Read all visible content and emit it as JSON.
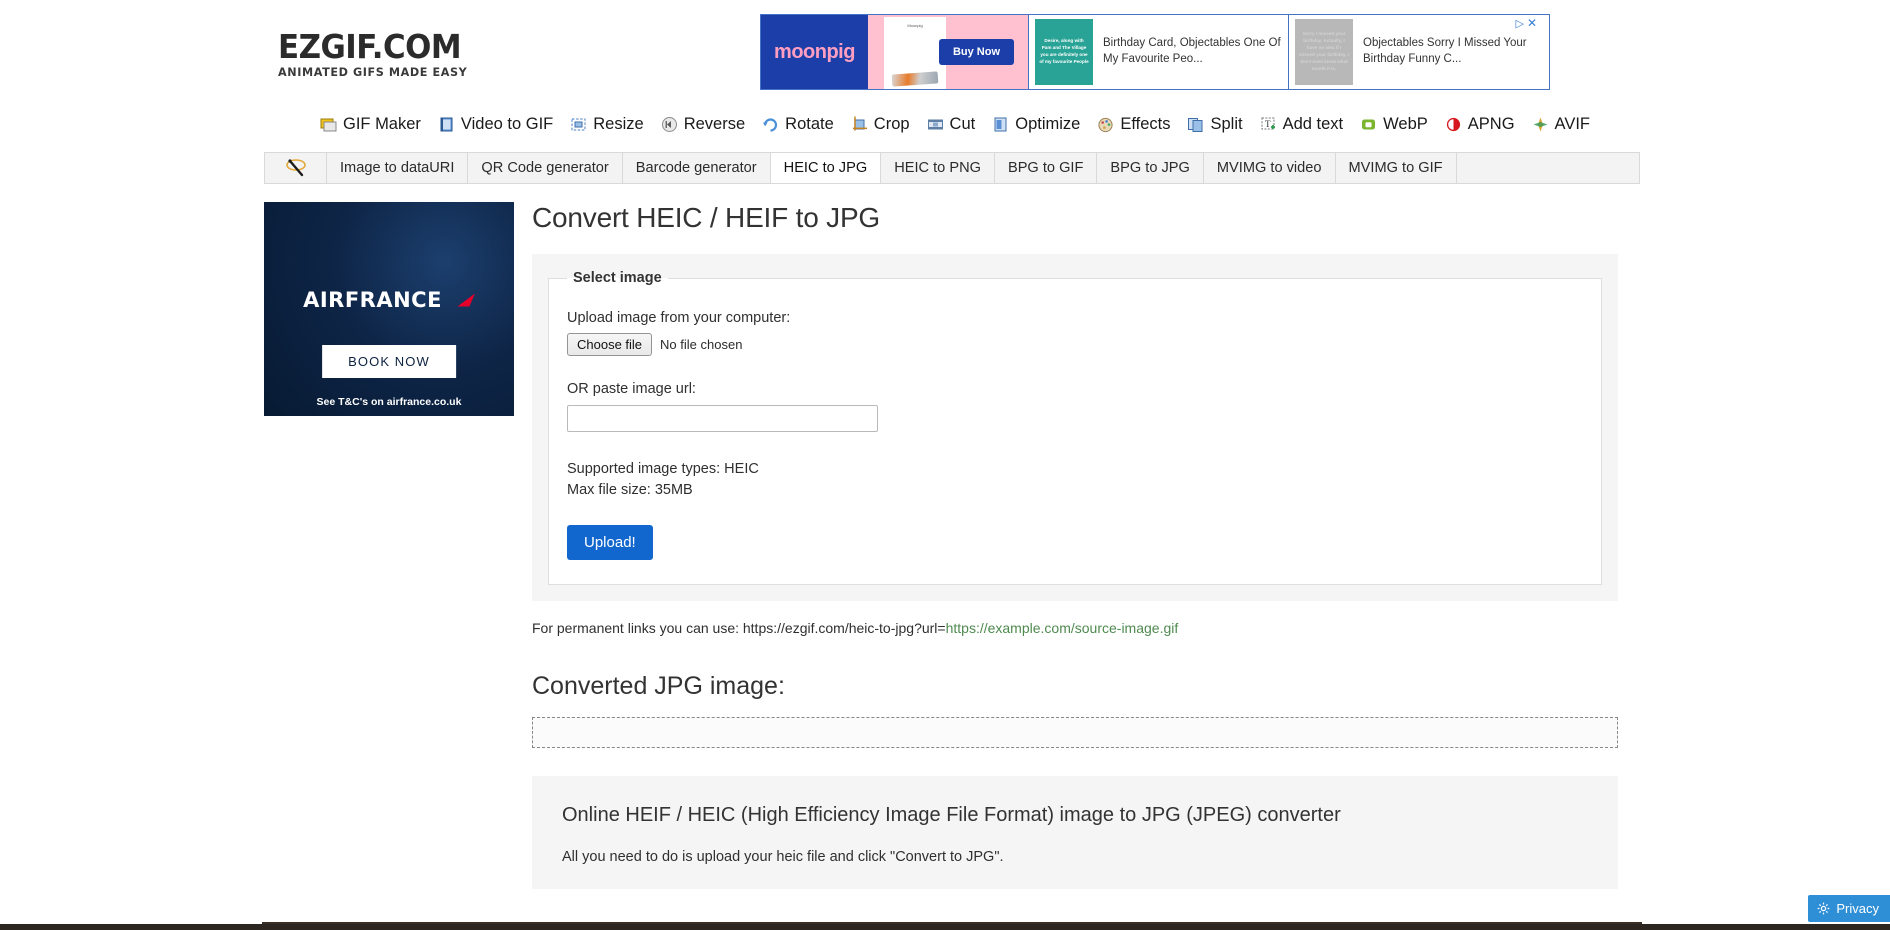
{
  "site": {
    "logo_main": "EZGIF.COM",
    "logo_tagline": "ANIMATED GIFS MADE EASY"
  },
  "ads": {
    "banner": {
      "slot1": {
        "brand": "moonpig",
        "card_caption": "Moonpig",
        "cta": "Buy Now"
      },
      "slot2": {
        "thumb_text": "Desire, along with Pam and The Village you are definitely one of my favourite People",
        "copy": "Birthday Card, Objectables One Of My Favourite Peo..."
      },
      "slot3": {
        "thumb_text": "Sorry I missed your birthday. Actually, I have no idea if I missed your birthday, I don't even know what month it is.",
        "copy": "Objectables Sorry I Missed Your Birthday Funny C..."
      },
      "adchoices_icon": "adchoices-icon",
      "close_icon": "close-icon"
    },
    "sidebar": {
      "brand": "AIRFRANCE",
      "cta": "BOOK NOW",
      "terms": "See T&C's on airfrance.co.uk"
    }
  },
  "main_nav": [
    {
      "label": "GIF Maker",
      "icon": "gif-maker-icon"
    },
    {
      "label": "Video to GIF",
      "icon": "video-to-gif-icon"
    },
    {
      "label": "Resize",
      "icon": "resize-icon"
    },
    {
      "label": "Reverse",
      "icon": "reverse-icon"
    },
    {
      "label": "Rotate",
      "icon": "rotate-icon"
    },
    {
      "label": "Crop",
      "icon": "crop-icon"
    },
    {
      "label": "Cut",
      "icon": "cut-icon"
    },
    {
      "label": "Optimize",
      "icon": "optimize-icon"
    },
    {
      "label": "Effects",
      "icon": "effects-icon"
    },
    {
      "label": "Split",
      "icon": "split-icon"
    },
    {
      "label": "Add text",
      "icon": "add-text-icon"
    },
    {
      "label": "WebP",
      "icon": "webp-icon"
    },
    {
      "label": "APNG",
      "icon": "apng-icon"
    },
    {
      "label": "AVIF",
      "icon": "avif-icon"
    }
  ],
  "sub_nav": {
    "wand_icon": "magic-wand-icon",
    "tabs": [
      {
        "label": "Image to dataURI",
        "active": false
      },
      {
        "label": "QR Code generator",
        "active": false
      },
      {
        "label": "Barcode generator",
        "active": false
      },
      {
        "label": "HEIC to JPG",
        "active": true
      },
      {
        "label": "HEIC to PNG",
        "active": false
      },
      {
        "label": "BPG to GIF",
        "active": false
      },
      {
        "label": "BPG to JPG",
        "active": false
      },
      {
        "label": "MVIMG to video",
        "active": false
      },
      {
        "label": "MVIMG to GIF",
        "active": false
      }
    ]
  },
  "page": {
    "title": "Convert HEIC / HEIF to JPG",
    "fieldset_legend": "Select image",
    "upload_label": "Upload image from your computer:",
    "choose_file_button": "Choose file",
    "no_file_chosen": "No file chosen",
    "url_label": "OR paste image url:",
    "url_value": "",
    "url_placeholder": "",
    "supported_types": "Supported image types: HEIC",
    "max_file_size": "Max file size: 35MB",
    "upload_button": "Upload!",
    "permanent_links_prefix": "For permanent links you can use: https://ezgif.com/heic-to-jpg?url=",
    "permanent_links_url": "https://example.com/source-image.gif",
    "converted_title": "Converted JPG image:",
    "info_title": "Online HEIF / HEIC (High Efficiency Image File Format) image to JPG (JPEG) converter",
    "info_paragraph": "All you need to do is upload your heic file and click \"Convert to JPG\"."
  },
  "privacy": {
    "label": "Privacy",
    "icon": "gear-icon"
  },
  "colors": {
    "accent_blue": "#1267cf",
    "link_green": "#4f8a4f",
    "privacy_blue": "#2f8fd6",
    "airfrance_red": "#e4002b",
    "moonpig_blue": "#1b3ea8",
    "moonpig_pink": "#ffc0cf"
  }
}
